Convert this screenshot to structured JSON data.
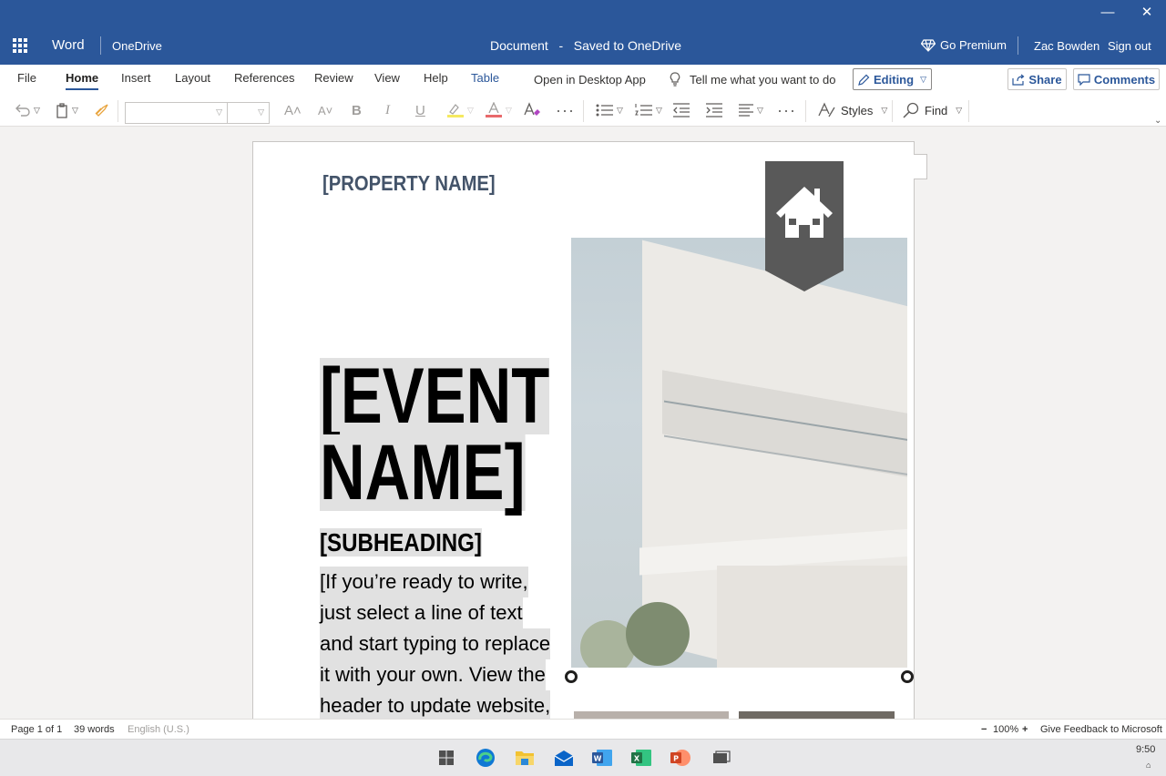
{
  "window": {
    "minimize": "—",
    "close": "✕"
  },
  "titlebar": {
    "app_name": "Word",
    "location": "OneDrive",
    "doc_title": "Document   -   Saved to OneDrive",
    "premium_label": "Go Premium",
    "user_name": "Zac Bowden",
    "sign_out": "Sign out"
  },
  "ribbon": {
    "tabs": [
      "File",
      "Home",
      "Insert",
      "Layout",
      "References",
      "Review",
      "View",
      "Help",
      "Table"
    ],
    "open_desktop": "Open in Desktop App",
    "tell_me": "Tell me what you want to do",
    "editing": "Editing",
    "share": "Share",
    "comments": "Comments"
  },
  "toolbar": {
    "styles": "Styles",
    "find": "Find"
  },
  "document": {
    "property_name": "[PROPERTY NAME]",
    "event_line1": "[EVENT",
    "event_line2": "NAME]",
    "subheading": "[SUBHEADING]",
    "body_lines": [
      "[If you’re ready to write,",
      "just select a line of text",
      "and start typing to replace",
      "it with your own. View the",
      "header to update website,"
    ]
  },
  "status": {
    "page": "Page 1 of 1",
    "words": "39 words",
    "language": "English (U.S.)",
    "zoom_minus": "−",
    "zoom": "100%",
    "zoom_plus": "+",
    "feedback": "Give Feedback to Microsoft"
  },
  "taskbar": {
    "time": "9:50",
    "tray": "⌂",
    "colors": {
      "edge": "#0f78d4",
      "explorer": "#f2c231",
      "mail": "#0a64c8",
      "word": "#2b579a",
      "excel": "#217346",
      "powerpoint": "#d04423"
    }
  },
  "colors": {
    "accent": "#2b579a",
    "banner": "#595959",
    "property_text": "#44546a"
  }
}
